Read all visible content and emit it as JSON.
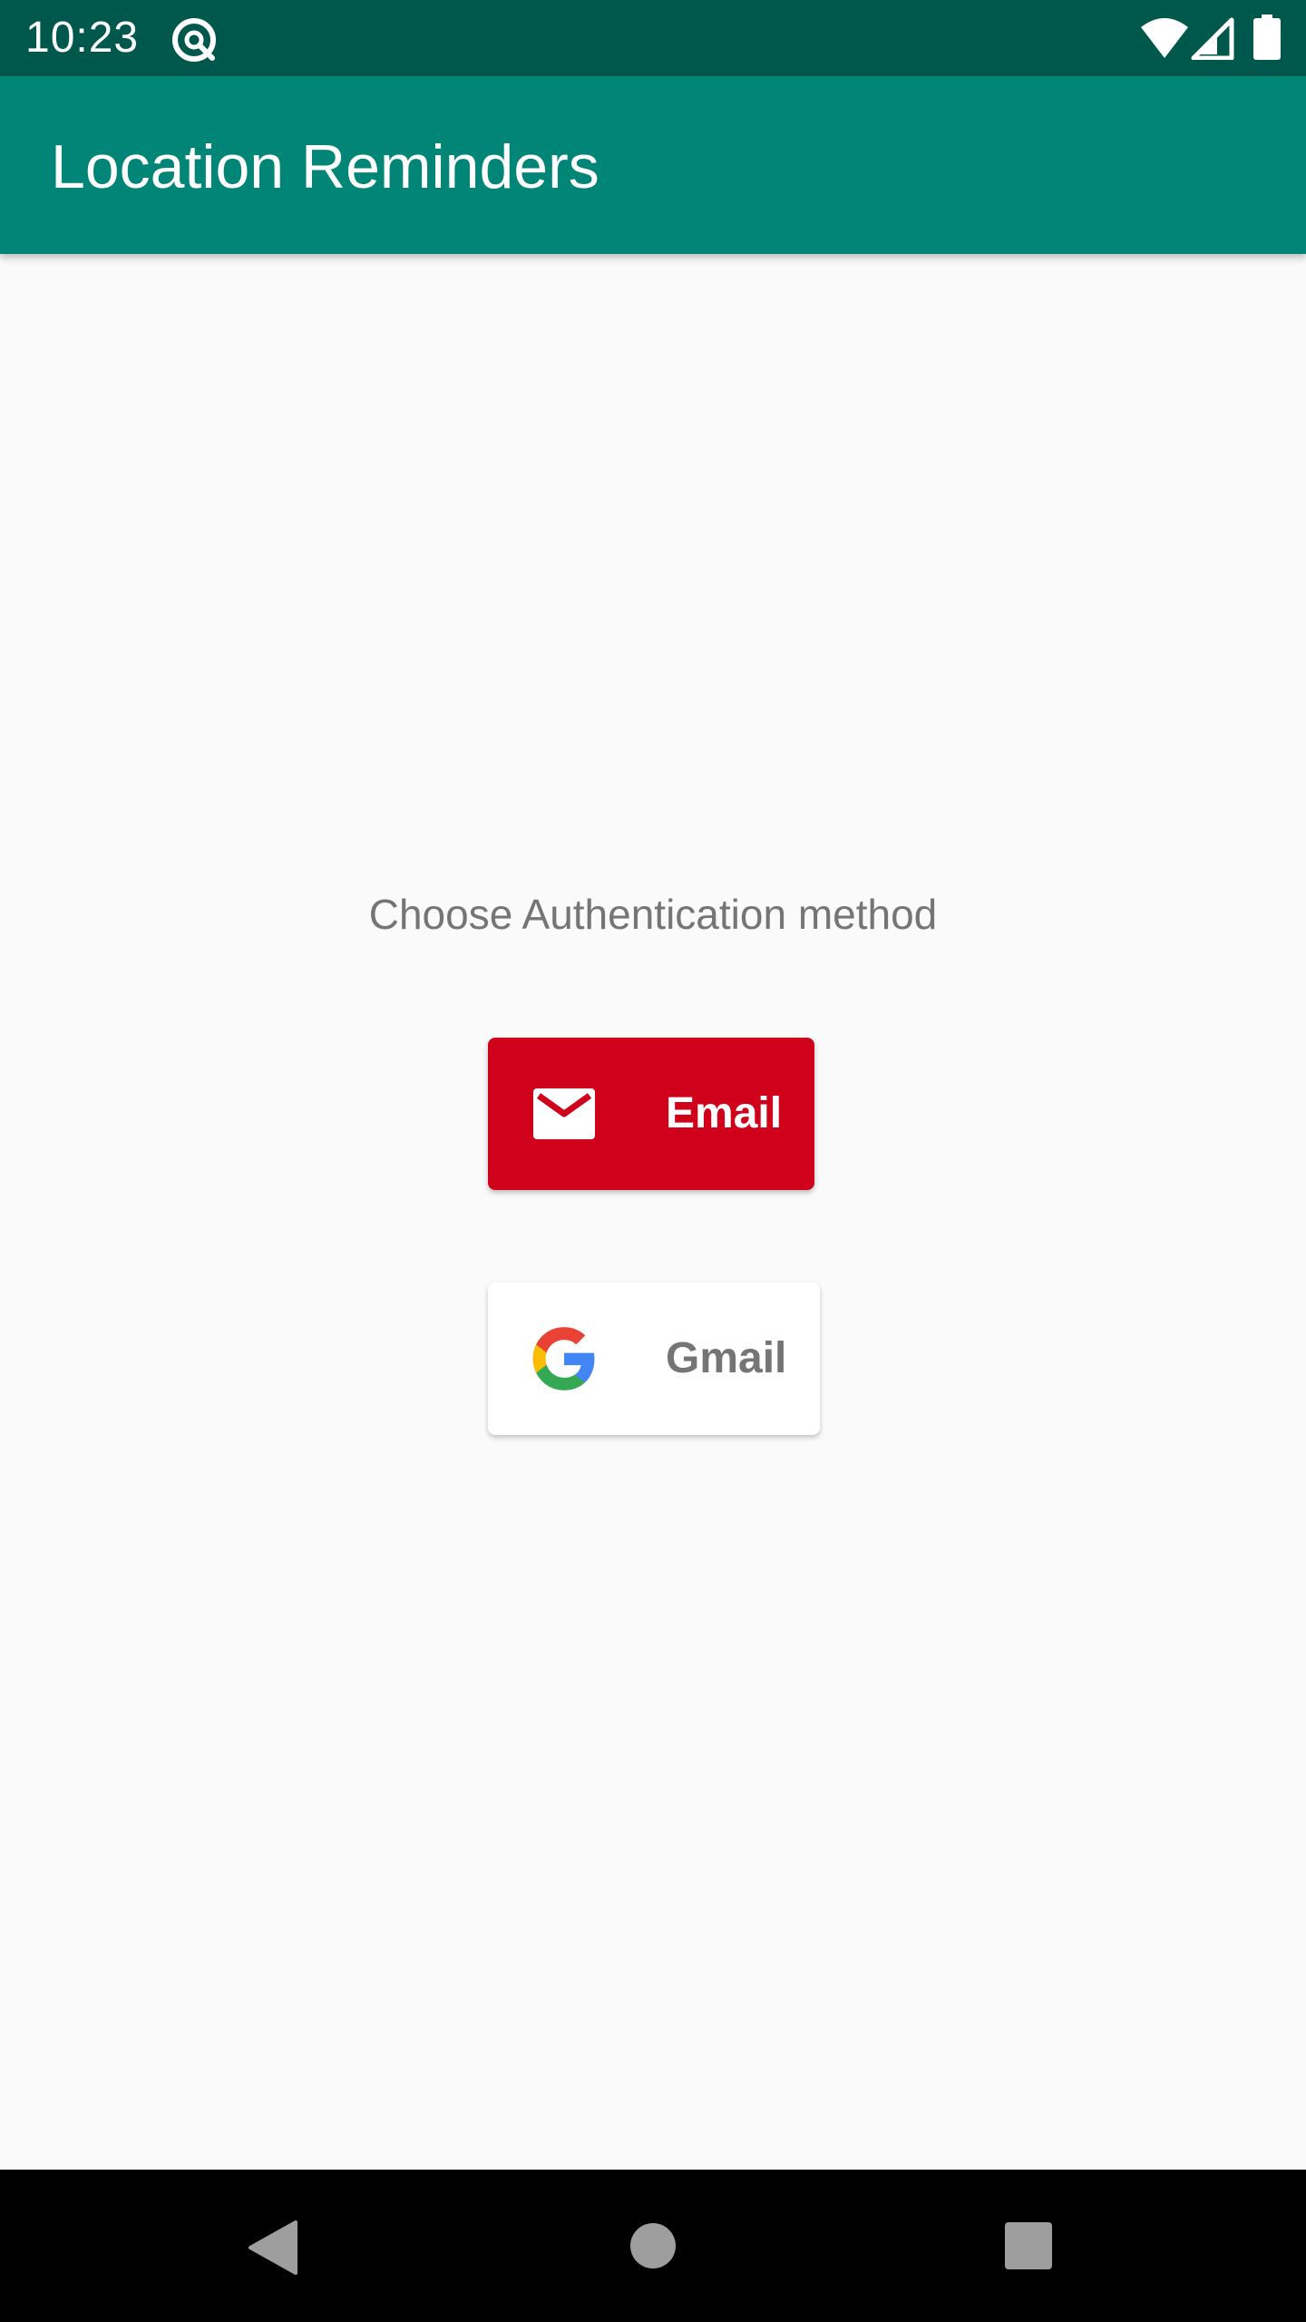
{
  "status_bar": {
    "time": "10:23",
    "icons": [
      "debug-icon",
      "wifi-icon",
      "signal-icon",
      "battery-icon"
    ],
    "background": "#00574b"
  },
  "app_bar": {
    "title": "Location Reminders",
    "background": "#008577"
  },
  "main": {
    "prompt": "Choose Authentication method",
    "buttons": [
      {
        "label": "Email",
        "icon": "mail-icon",
        "background": "#d0021b",
        "text_color": "#ffffff"
      },
      {
        "label": "Gmail",
        "icon": "google-icon",
        "background": "#ffffff",
        "text_color": "#757575"
      }
    ]
  },
  "nav_bar": {
    "icons": [
      "back-icon",
      "home-icon",
      "recents-icon"
    ]
  }
}
